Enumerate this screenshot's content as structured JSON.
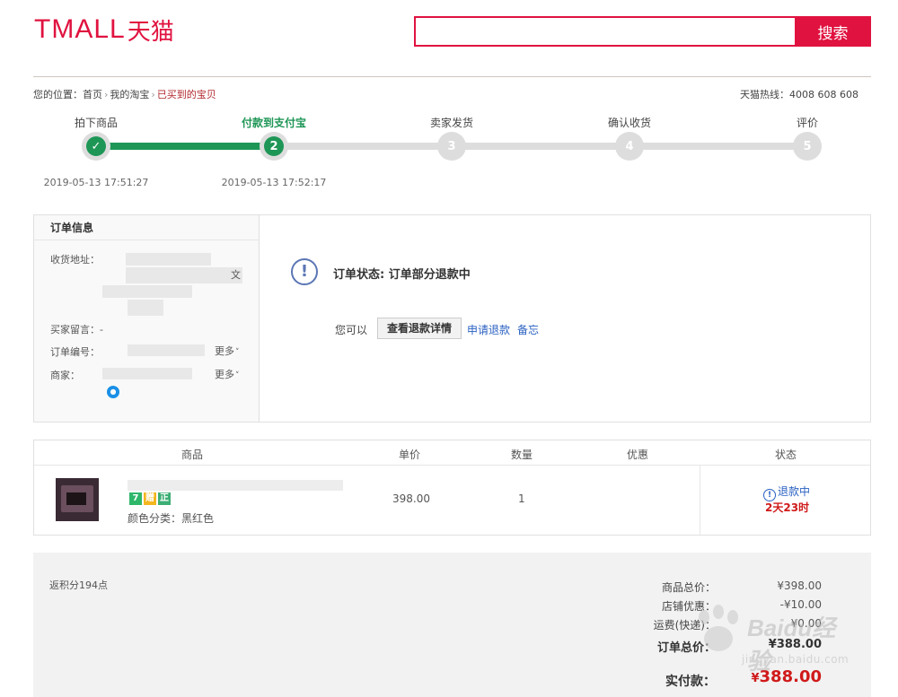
{
  "header": {
    "logo_latin": "TMALL",
    "logo_cn": "天猫",
    "search": {
      "value": "",
      "placeholder": "",
      "button_label": "搜索"
    }
  },
  "breadcrumb": {
    "prefix": "您的位置：",
    "items": [
      "首页",
      "我的淘宝",
      "已买到的宝贝"
    ],
    "separator": "›",
    "hotline": "天猫热线：4008 608 608"
  },
  "progress": {
    "steps": [
      {
        "label": "拍下商品",
        "number": "✓",
        "time": "2019-05-13 17:51:27",
        "state": "done"
      },
      {
        "label": "付款到支付宝",
        "number": "2",
        "time": "2019-05-13 17:52:17",
        "state": "current"
      },
      {
        "label": "卖家发货",
        "number": "3",
        "time": "",
        "state": "pending"
      },
      {
        "label": "确认收货",
        "number": "4",
        "time": "",
        "state": "pending"
      },
      {
        "label": "评价",
        "number": "5",
        "time": "",
        "state": "pending"
      }
    ],
    "colors": {
      "done": "#1e9656",
      "pending": "#dddddd"
    }
  },
  "order_info": {
    "title": "订单信息",
    "address_label": "收货地址：",
    "address_tail": "文",
    "buyer_note_label": "买家留言：",
    "buyer_note_value": "-",
    "order_no_label": "订单编号：",
    "merchant_label": "商家：",
    "more_label": "更多"
  },
  "order_status": {
    "icon": "exclamation-circle-icon",
    "text": "订单状态: 订单部分退款中",
    "you_can": "您可以",
    "view_refund_button": "查看退款详情",
    "apply_refund_link": "申请退款",
    "note_link": "备忘"
  },
  "items_table": {
    "headers": [
      "商品",
      "单价",
      "数量",
      "优惠",
      "状态"
    ],
    "rows": [
      {
        "badges": [
          "7",
          "赠",
          "正"
        ],
        "sku": "颜色分类：黑红色",
        "price": "398.00",
        "quantity": "1",
        "discount": "",
        "status": "退款中",
        "status_time": "2天23时"
      }
    ]
  },
  "summary": {
    "points": "返积分194点",
    "lines": [
      {
        "label": "商品总价：",
        "value": "¥398.00"
      },
      {
        "label": "店铺优惠：",
        "value": "-¥10.00"
      },
      {
        "label": "运费(快递)：",
        "value": "¥0.00"
      },
      {
        "label": "订单总价：",
        "value": "¥388.00"
      }
    ],
    "pay_label": "实付款：",
    "pay_currency": "¥",
    "pay_value": "388.00"
  },
  "watermark": {
    "text": "Baidu经验",
    "sub": "jingyan.baidu.com"
  },
  "colors": {
    "brand": "#e0123f",
    "link": "#2a61c2",
    "price_red": "#d01a1a",
    "success": "#1e9656"
  }
}
